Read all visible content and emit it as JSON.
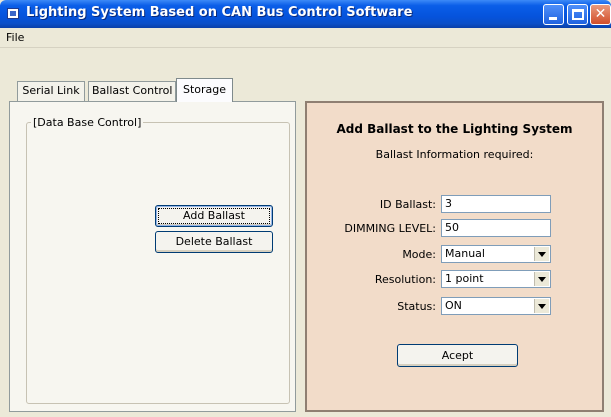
{
  "window": {
    "title": "Lighting System Based on CAN Bus Control Software"
  },
  "menu": {
    "file": "File"
  },
  "tabs": [
    {
      "label": "Serial Link"
    },
    {
      "label": "Ballast Control"
    },
    {
      "label": "Storage"
    }
  ],
  "active_tab": "Storage",
  "left_panel": {
    "group_title": "[Data Base Control]",
    "add_button": "Add Ballast",
    "delete_button": "Delete Ballast"
  },
  "right_panel": {
    "heading": "Add Ballast to the Lighting System",
    "subheading": "Ballast Information required:",
    "fields": {
      "id_ballast": {
        "label": "ID Ballast:",
        "value": "3"
      },
      "dimming_level": {
        "label": "DIMMING LEVEL:",
        "value": "50"
      },
      "mode": {
        "label": "Mode:",
        "value": "Manual"
      },
      "resolution": {
        "label": "Resolution:",
        "value": "1 point"
      },
      "status": {
        "label": "Status:",
        "value": "ON"
      }
    },
    "accept_button": "Acept"
  },
  "colors": {
    "titlebar": "#0553dc",
    "right_panel_bg": "#f2dcc9",
    "close_button": "#d24e2a"
  },
  "icons": [
    "app-icon",
    "minimize-icon",
    "maximize-icon",
    "close-icon",
    "dropdown-arrow-icon"
  ]
}
